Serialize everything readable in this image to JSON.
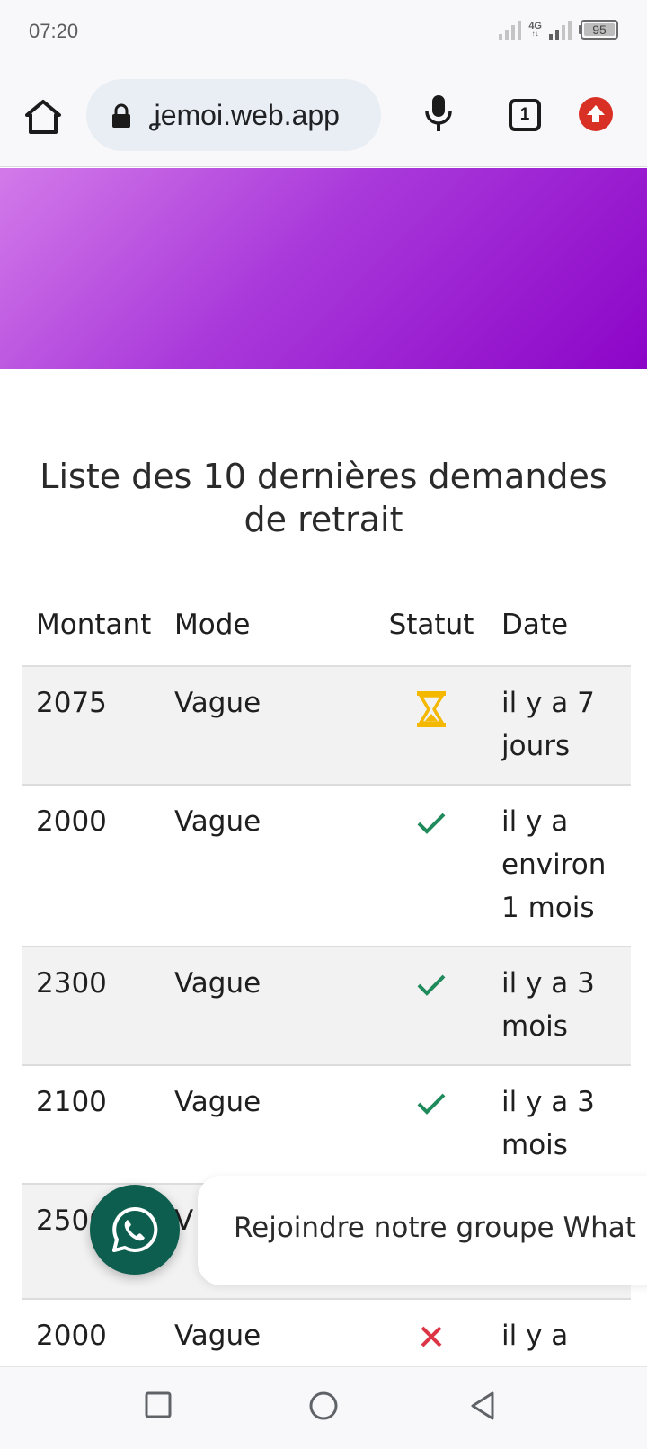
{
  "status_bar": {
    "time": "07:20",
    "network": "4G",
    "battery": "95"
  },
  "browser": {
    "url": "ʝemoi.web.app",
    "tab_count": "1",
    "icons": [
      "home-icon",
      "lock-icon",
      "mic-icon",
      "tabs-icon",
      "update-icon"
    ]
  },
  "page": {
    "title": "Liste des 10 dernières demandes de retrait",
    "hero_colors": [
      "#d37ae9",
      "#8c05c8"
    ],
    "table": {
      "headers": [
        "Montant",
        "Mode",
        "Statut",
        "Date"
      ],
      "rows": [
        {
          "montant": "2075",
          "mode": "Vague",
          "statut": "pending",
          "date": "il y a 7 jours"
        },
        {
          "montant": "2000",
          "mode": "Vague",
          "statut": "success",
          "date": "il y a environ 1 mois"
        },
        {
          "montant": "2300",
          "mode": "Vague",
          "statut": "success",
          "date": "il y a 3 mois"
        },
        {
          "montant": "2100",
          "mode": "Vague",
          "statut": "success",
          "date": "il y a 3 mois"
        },
        {
          "montant": "2500",
          "mode": "V",
          "statut": "",
          "date": ""
        },
        {
          "montant": "2000",
          "mode": "Vague",
          "statut": "failed",
          "date": "il y a environ"
        }
      ]
    },
    "status_colors": {
      "pending": "#f5b800",
      "success": "#1f8a5b",
      "failed": "#dc3545"
    }
  },
  "whatsapp": {
    "banner_text": "Rejoindre notre groupe What",
    "color": "#0e5e4f"
  },
  "nav": {
    "icons": [
      "recents-icon",
      "home-circle-icon",
      "back-icon"
    ]
  }
}
